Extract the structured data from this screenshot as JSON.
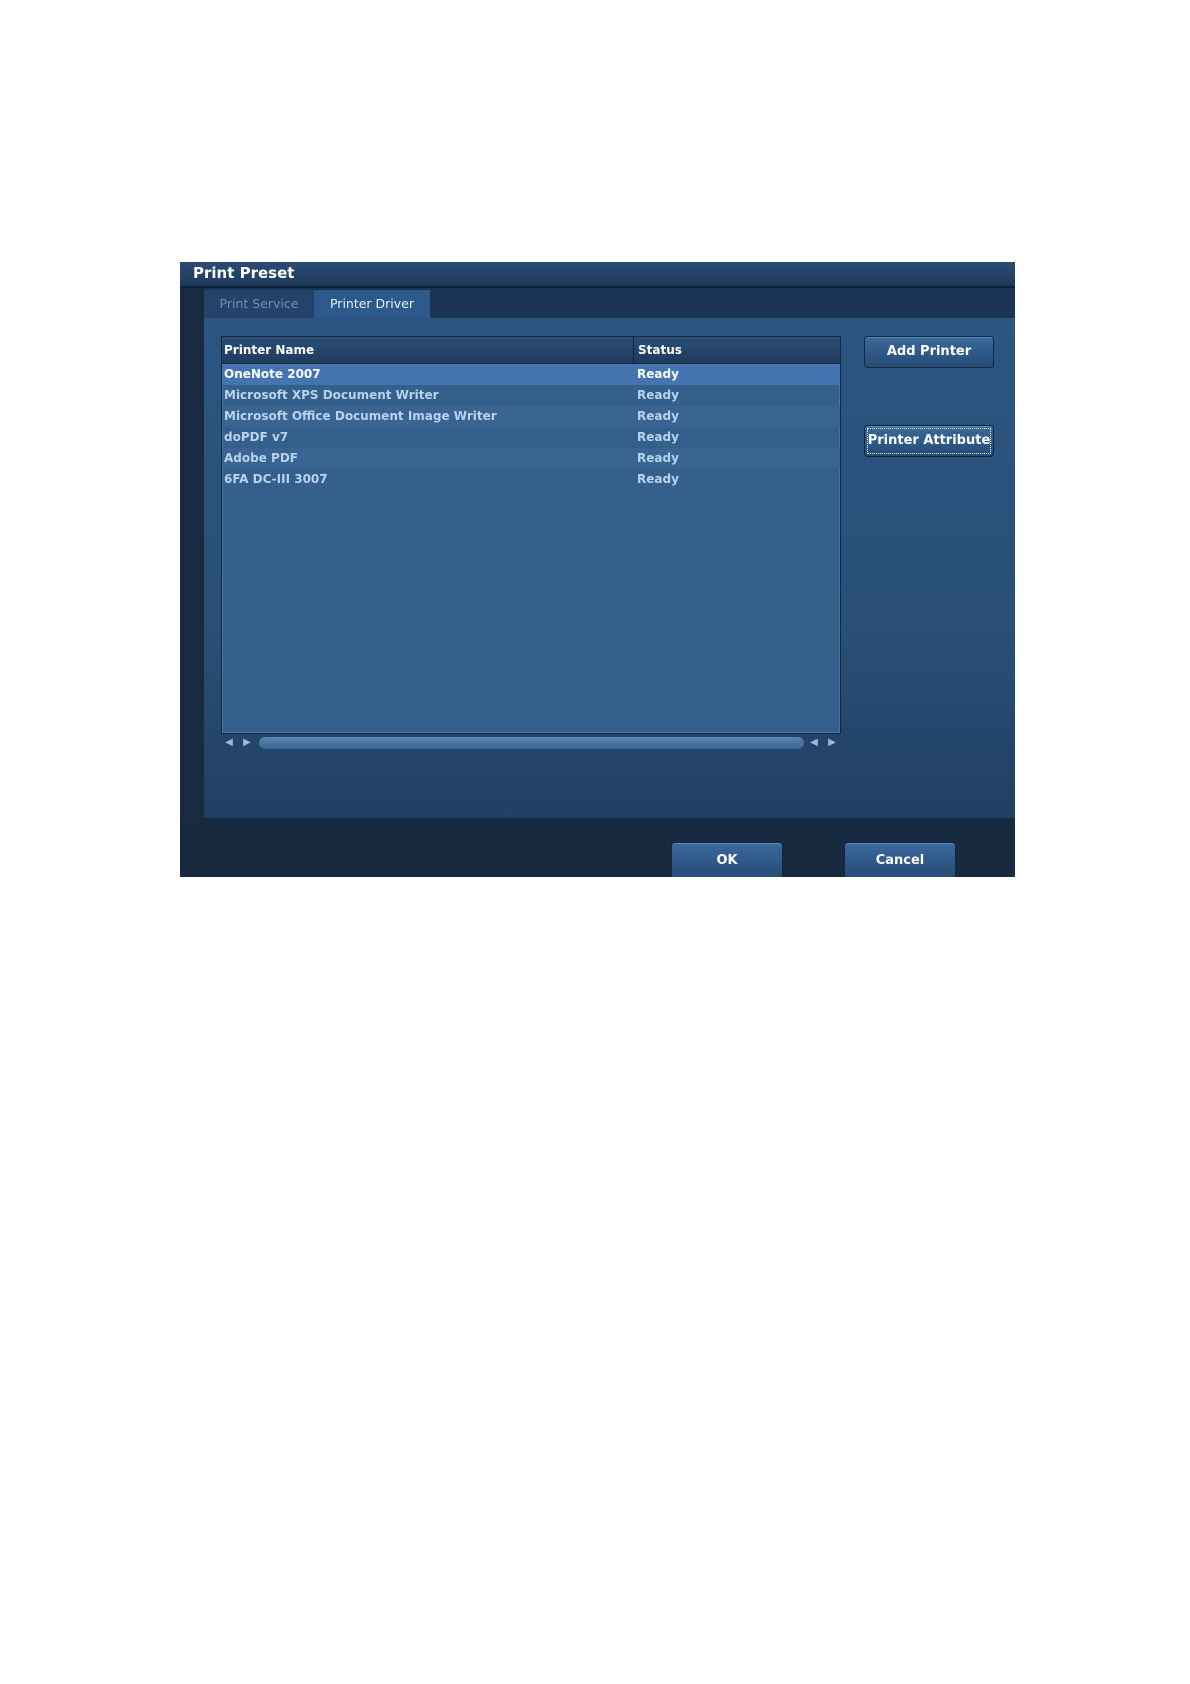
{
  "dialog": {
    "title": "Print Preset"
  },
  "tabs": [
    {
      "label": "Print Service",
      "active": false
    },
    {
      "label": "Printer Driver",
      "active": true
    }
  ],
  "printer_list": {
    "columns": [
      "Printer Name",
      "Status"
    ],
    "rows": [
      {
        "name": "OneNote 2007",
        "status": "Ready",
        "selected": true
      },
      {
        "name": "Microsoft XPS Document Writer",
        "status": "Ready",
        "selected": false
      },
      {
        "name": "Microsoft Office Document Image Writer",
        "status": "Ready",
        "selected": false
      },
      {
        "name": "doPDF v7",
        "status": "Ready",
        "selected": false
      },
      {
        "name": "Adobe PDF",
        "status": "Ready",
        "selected": false
      },
      {
        "name": "6FA DC-III 3007",
        "status": "Ready",
        "selected": false
      }
    ]
  },
  "side_buttons": {
    "add_printer": "Add Printer",
    "printer_attribute": "Printer Attribute"
  },
  "footer": {
    "ok": "OK",
    "cancel": "Cancel"
  },
  "icons": {
    "scroll_left": "triangle-left-icon",
    "scroll_right": "triangle-right-icon"
  },
  "colors": {
    "dialog_bg": "#1a2a40",
    "content_bg": "#2c5582",
    "selection": "#4575b0",
    "text_light": "#b9d3ee"
  }
}
